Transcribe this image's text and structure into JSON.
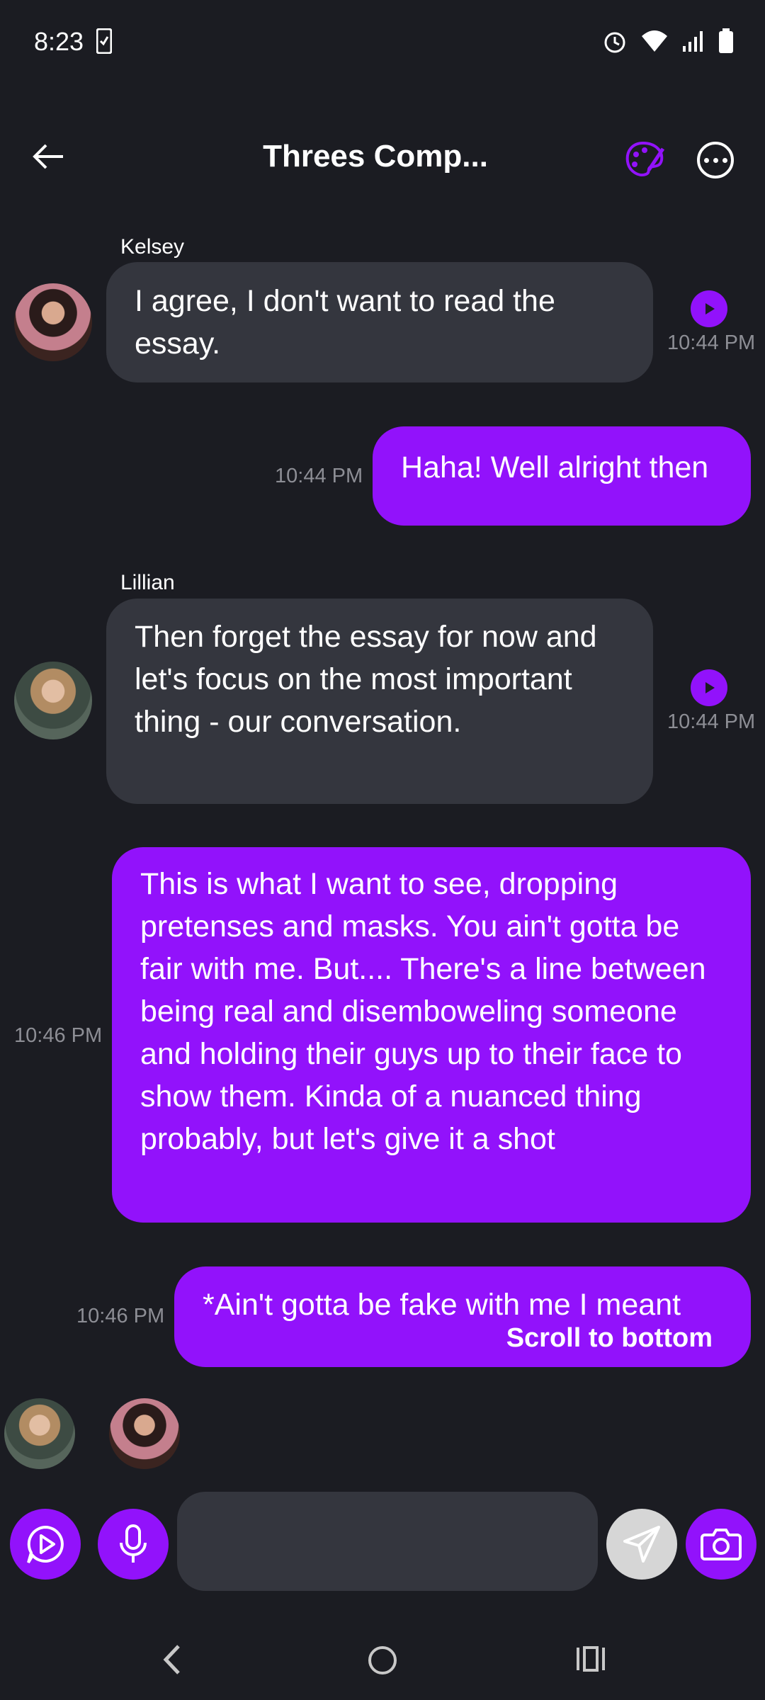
{
  "status_bar": {
    "time": "8:23"
  },
  "header": {
    "title": "Threes Comp..."
  },
  "messages": [
    {
      "sender": "Kelsey",
      "text": "I agree, I don't want to read the essay.",
      "time": "10:44 PM",
      "direction": "incoming"
    },
    {
      "text": "Haha! Well alright then",
      "time": "10:44 PM",
      "direction": "outgoing"
    },
    {
      "sender": "Lillian",
      "text": "Then forget the essay for now and let's focus on the most important thing - our conversation.",
      "time": "10:44 PM",
      "direction": "incoming"
    },
    {
      "text": "This is what I want to see, dropping pretenses and masks. You ain't gotta be fair with me. But.... There's a line between being real and disemboweling someone and holding their guys up to their face to show them. Kinda of a nuanced thing probably, but let's give it a shot",
      "time": "10:46 PM",
      "direction": "outgoing"
    },
    {
      "text": "*Ain't gotta be fake with me I meant",
      "time": "10:46 PM",
      "direction": "outgoing"
    }
  ],
  "scroll_to_bottom_label": "Scroll to bottom",
  "input": {
    "placeholder": ""
  },
  "colors": {
    "accent": "#9212fb",
    "background": "#1b1c22",
    "incoming_bubble": "#34363e"
  },
  "icons": [
    "back-arrow-icon",
    "palette-icon",
    "more-icon",
    "play-icon",
    "voice-chat-icon",
    "microphone-icon",
    "send-icon",
    "camera-icon"
  ]
}
